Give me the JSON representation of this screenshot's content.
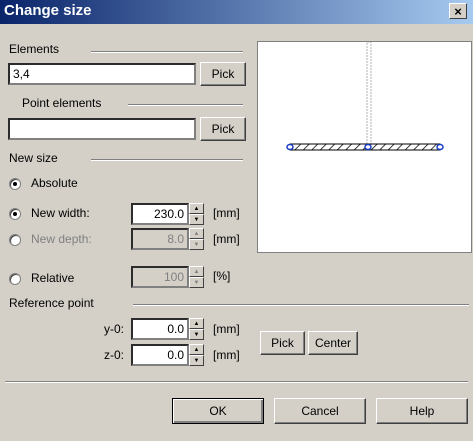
{
  "window": {
    "title": "Change size",
    "close_glyph": "×"
  },
  "elements": {
    "label": "Elements",
    "value": "3,4",
    "pick_label": "Pick"
  },
  "point_elements": {
    "label": "Point elements",
    "value": "",
    "pick_label": "Pick"
  },
  "new_size": {
    "label": "New size",
    "absolute_label": "Absolute",
    "new_width_label": "New width:",
    "new_width_value": "230.0",
    "new_width_unit": "[mm]",
    "new_depth_label": "New depth:",
    "new_depth_value": "8.0",
    "new_depth_unit": "[mm]",
    "relative_label": "Relative",
    "relative_value": "100",
    "relative_unit": "[%]"
  },
  "reference_point": {
    "label": "Reference point",
    "y0_label": "y-0:",
    "y0_value": "0.0",
    "y0_unit": "[mm]",
    "z0_label": "z-0:",
    "z0_value": "0.0",
    "z0_unit": "[mm]",
    "pick_label": "Pick",
    "center_label": "Center"
  },
  "buttons": {
    "ok": "OK",
    "cancel": "Cancel",
    "help": "Help"
  },
  "colors": {
    "title_gradient_start": "#0a246a",
    "title_gradient_end": "#a6caf0",
    "dialog_bg": "#d4d0c8",
    "beam_node": "#1a3dc8"
  }
}
